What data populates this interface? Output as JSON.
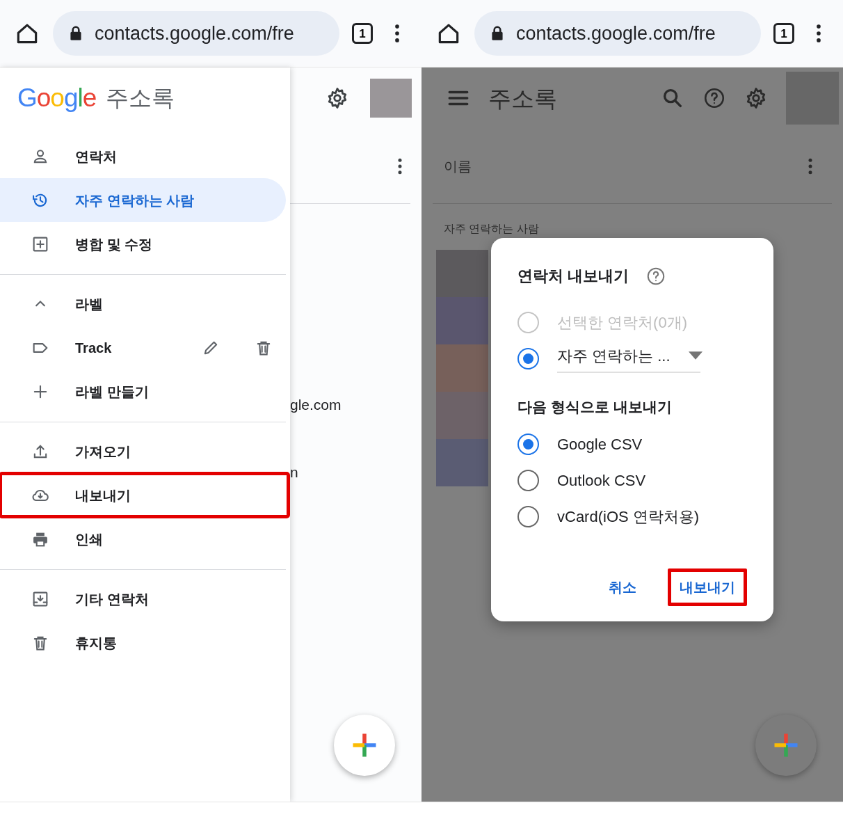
{
  "left_screen": {
    "browser": {
      "url": "contacts.google.com/fre",
      "tab_count": "1"
    },
    "drawer": {
      "logo": "Google",
      "title": "주소록",
      "groups": [
        [
          {
            "label": "연락처",
            "selected": false,
            "highlighted": false
          },
          {
            "label": "자주 연락하는 사람",
            "selected": true,
            "highlighted": false
          },
          {
            "label": "병합 및 수정",
            "selected": false,
            "highlighted": false
          }
        ],
        [
          {
            "label": "라벨",
            "kind": "header",
            "expanded": true,
            "selected": false,
            "highlighted": false
          },
          {
            "label": "Track",
            "kind": "label",
            "selected": false,
            "highlighted": false
          },
          {
            "label": "라벨 만들기",
            "selected": false,
            "highlighted": false
          }
        ],
        [
          {
            "label": "가져오기",
            "selected": false,
            "highlighted": false
          },
          {
            "label": "내보내기",
            "selected": false,
            "highlighted": true
          },
          {
            "label": "인쇄",
            "selected": false,
            "highlighted": false
          }
        ],
        [
          {
            "label": "기타 연락처",
            "selected": false,
            "highlighted": false
          },
          {
            "label": "휴지통",
            "selected": false,
            "highlighted": false
          }
        ]
      ]
    },
    "page_behind": {
      "texts": [
        "gle.com",
        "n"
      ]
    }
  },
  "right_screen": {
    "browser": {
      "url": "contacts.google.com/fre",
      "tab_count": "1"
    },
    "app_bar": {
      "title": "주소록"
    },
    "list_header": "이름",
    "section_label": "자주 연락하는 사람",
    "contacts": [
      {
        "color": "#5c5a5d"
      },
      {
        "color": "#5a566e"
      },
      {
        "color": "#77605a"
      },
      {
        "color": "#6d6268"
      },
      {
        "color": "#5a5c73"
      }
    ],
    "dialog": {
      "title": "연락처 내보내기",
      "scope_options": [
        {
          "label": "선택한 연락처(0개)",
          "selected": false,
          "disabled": true
        },
        {
          "label": "자주 연락하는 ...",
          "kind": "dropdown",
          "selected": true,
          "disabled": false
        }
      ],
      "format_heading": "다음 형식으로 내보내기",
      "formats": [
        {
          "label": "Google CSV",
          "selected": true
        },
        {
          "label": "Outlook CSV",
          "selected": false
        },
        {
          "label": "vCard(iOS 연락처용)",
          "selected": false
        }
      ],
      "buttons": [
        {
          "label": "취소",
          "highlighted": false
        },
        {
          "label": "내보내기",
          "highlighted": true
        }
      ]
    }
  }
}
